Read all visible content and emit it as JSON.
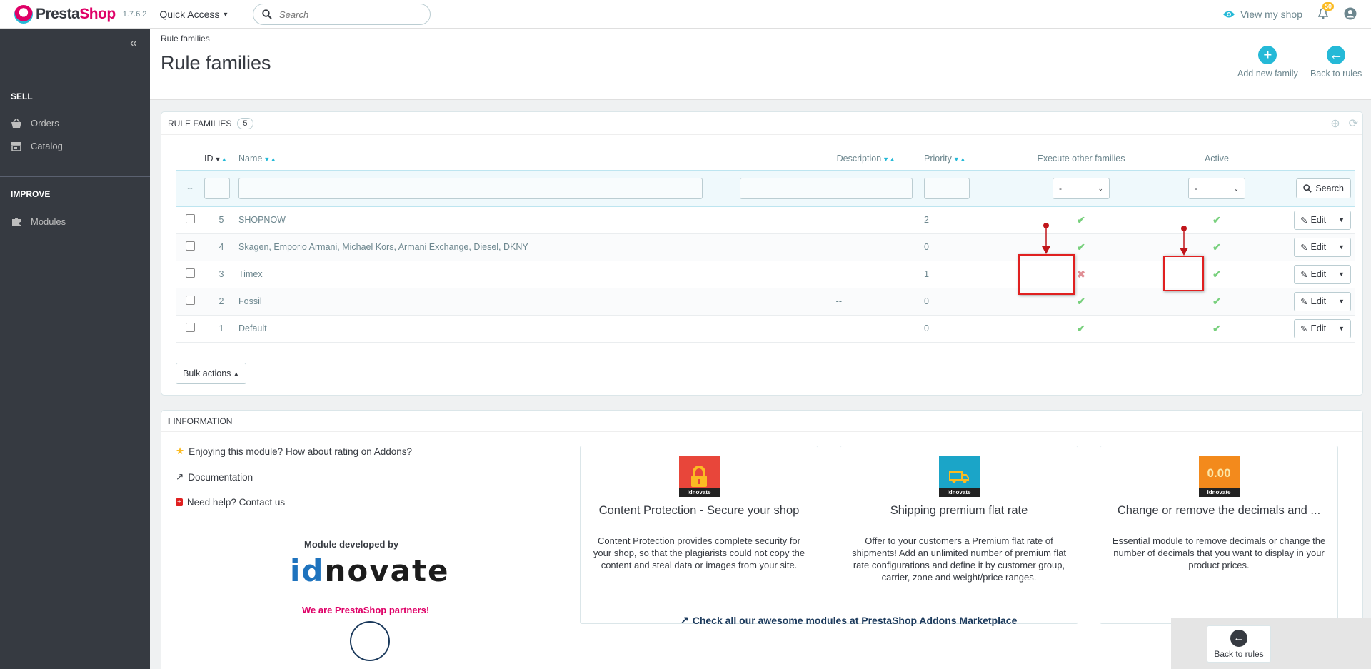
{
  "header": {
    "logo_text_a": "Presta",
    "logo_text_b": "Shop",
    "version": "1.7.6.2",
    "quick_access": "Quick Access",
    "search_placeholder": "Search",
    "view_shop": "View my shop",
    "notification_count": "50"
  },
  "sidebar": {
    "sections": [
      {
        "title": "SELL",
        "items": [
          "Orders",
          "Catalog"
        ]
      },
      {
        "title": "IMPROVE",
        "items": [
          "Modules"
        ]
      }
    ]
  },
  "page": {
    "breadcrumb": "Rule families",
    "title": "Rule families",
    "toolbar": {
      "add": "Add new family",
      "back": "Back to rules"
    }
  },
  "list_panel": {
    "title": "RULE FAMILIES",
    "count": "5",
    "columns": {
      "id": "ID",
      "name": "Name",
      "description": "Description",
      "priority": "Priority",
      "execute": "Execute other families",
      "active": "Active"
    },
    "filter_placeholder_dash": "--",
    "select_default": "-",
    "search_button": "Search",
    "edit_label": "Edit",
    "rows": [
      {
        "id": "5",
        "name": "SHOPNOW",
        "description": "",
        "priority": "2",
        "execute": true,
        "active": true
      },
      {
        "id": "4",
        "name": "Skagen, Emporio Armani, Michael Kors, Armani Exchange, Diesel, DKNY",
        "description": "",
        "priority": "0",
        "execute": true,
        "active": true
      },
      {
        "id": "3",
        "name": "Timex",
        "description": "",
        "priority": "1",
        "execute": false,
        "active": true
      },
      {
        "id": "2",
        "name": "Fossil",
        "description": "--",
        "priority": "0",
        "execute": true,
        "active": true
      },
      {
        "id": "1",
        "name": "Default",
        "description": "",
        "priority": "0",
        "execute": true,
        "active": true
      }
    ],
    "bulk_actions": "Bulk actions"
  },
  "info_panel": {
    "title": "INFORMATION",
    "links": [
      "Enjoying this module? How about rating on Addons?",
      "Documentation",
      "Need help? Contact us"
    ],
    "developed_by": "Module developed by",
    "brand_a": "id",
    "brand_b": "novate",
    "partners": "We are PrestaShop partners!",
    "cards": [
      {
        "title": "Content Protection - Secure your shop",
        "text": "Content Protection provides complete security for your shop, so that the plagiarists could not copy the content and steal data or images from your site.",
        "thumb_color": "#e8463a",
        "thumb_label": ""
      },
      {
        "title": "Shipping premium flat rate",
        "text": "Offer to your customers a Premium flat rate of shipments! Add an unlimited number of premium flat rate configurations and define it by customer group, carrier, zone and weight/price ranges.",
        "thumb_color": "#1ba5c8",
        "thumb_label": ""
      },
      {
        "title": "Change or remove the decimals and ...",
        "text": "Essential module to remove decimals or change the number of decimals that you want to display in your product prices.",
        "thumb_color": "#f38a1c",
        "thumb_label": "0.00"
      }
    ],
    "thumb_brand": "idnovate",
    "addons_link": "Check all our awesome modules at PrestaShop Addons Marketplace"
  },
  "floating": {
    "back": "Back to rules"
  }
}
